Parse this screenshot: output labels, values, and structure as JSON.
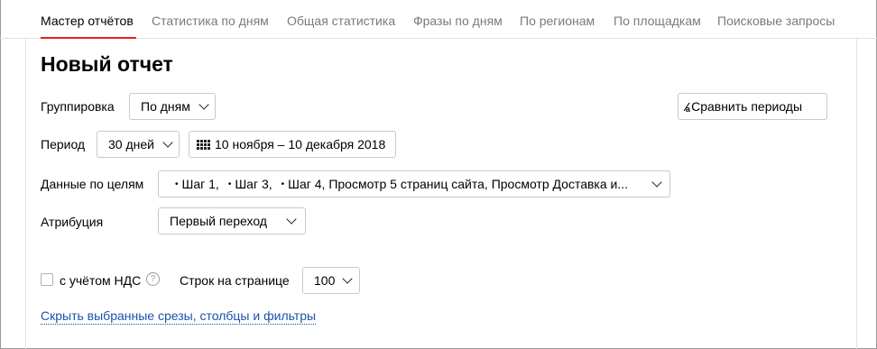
{
  "tabs": [
    {
      "label": "Мастер отчётов"
    },
    {
      "label": "Статистика по дням"
    },
    {
      "label": "Общая статистика"
    },
    {
      "label": "Фразы по дням"
    },
    {
      "label": "По регионам"
    },
    {
      "label": "По площадкам"
    },
    {
      "label": "Поисковые запросы"
    }
  ],
  "page": {
    "title": "Новый отчет"
  },
  "grouping": {
    "label": "Группировка",
    "value": "По дням"
  },
  "compare": {
    "label": "Сравнить периоды",
    "icon": "compare-periods-icon"
  },
  "period": {
    "label": "Период",
    "preset": "30 дней",
    "range": "10 ноября – 10 декабря 2018",
    "icon": "calendar-icon"
  },
  "goals": {
    "label": "Данные по целям",
    "items": [
      "Шаг 1,",
      "Шаг 3,",
      "Шаг 4, Просмотр 5 страниц сайта,  Просмотр Доставка и..."
    ]
  },
  "attribution": {
    "label": "Атрибуция",
    "value": "Первый переход"
  },
  "vat": {
    "label": "с учётом НДС",
    "checked": false,
    "help": "?"
  },
  "rows_per_page": {
    "label": "Строк на странице",
    "value": "100"
  },
  "hide_link": {
    "label": "Скрыть выбранные срезы, столбцы и фильтры"
  },
  "colors": {
    "accent_red": "#e2231a",
    "link_blue": "#1a52a8"
  }
}
